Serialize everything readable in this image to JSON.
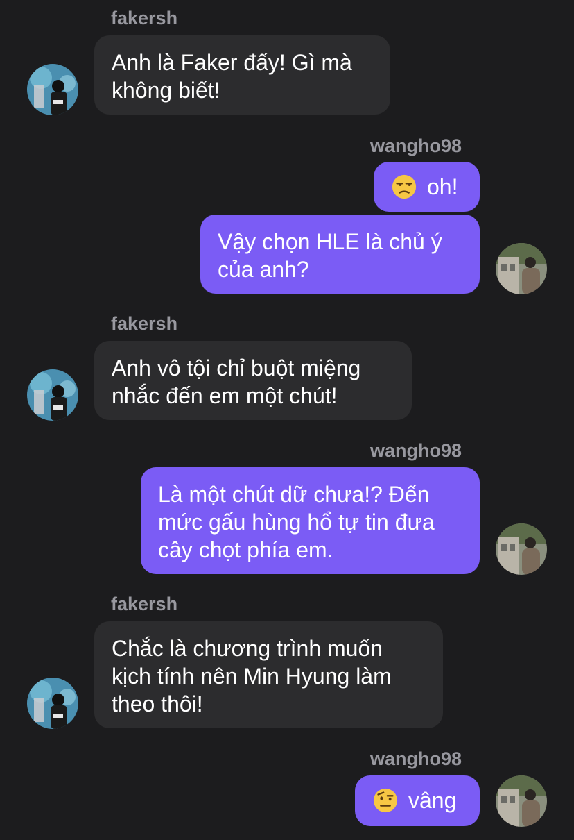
{
  "messages": [
    {
      "sender": "fakersh",
      "lines": [
        "Anh là Faker đấy! Gì mà",
        "không biết!"
      ]
    },
    {
      "sender": "wangho98",
      "emoji": "unamused-face-icon",
      "lines": [
        "oh!"
      ]
    },
    {
      "lines": [
        "Vậy chọn HLE là chủ ý",
        "của anh?"
      ]
    },
    {
      "sender": "fakersh",
      "lines": [
        "Anh vô tội chỉ buột miệng",
        "nhắc đến em một chút!"
      ]
    },
    {
      "sender": "wangho98",
      "lines": [
        "Là một chút dữ chưa!? Đến",
        "mức gấu hùng hổ tự tin đưa",
        "cây chọt phía em."
      ]
    },
    {
      "sender": "fakersh",
      "lines": [
        "Chắc là chương trình muốn",
        "kịch tính nên Min Hyung làm",
        "theo thôi!"
      ]
    },
    {
      "sender": "wangho98",
      "emoji": "face-with-raised-eyebrow-icon",
      "lines": [
        "vâng"
      ]
    }
  ],
  "colors": {
    "background": "#1c1c1e",
    "incoming_bubble": "#2c2c2e",
    "outgoing_bubble": "#7b5cf5",
    "sender_name": "#98989f"
  }
}
